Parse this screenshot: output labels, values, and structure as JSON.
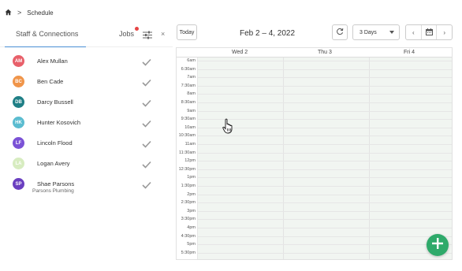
{
  "breadcrumb": {
    "home_icon": "home-icon",
    "separator": ">",
    "current": "Schedule"
  },
  "left_panel": {
    "tabs": {
      "staff": "Staff & Connections",
      "jobs": "Jobs"
    },
    "close": "×",
    "staff": [
      {
        "initials": "AM",
        "name": "Alex Mullan",
        "color": "#e8606a",
        "sub": ""
      },
      {
        "initials": "BC",
        "name": "Ben Cade",
        "color": "#f0954a",
        "sub": ""
      },
      {
        "initials": "DB",
        "name": "Darcy Bussell",
        "color": "#1f7f86",
        "sub": ""
      },
      {
        "initials": "HK",
        "name": "Hunter Kosovich",
        "color": "#5bbcd0",
        "sub": ""
      },
      {
        "initials": "LF",
        "name": "Lincoln Flood",
        "color": "#7b52d6",
        "sub": ""
      },
      {
        "initials": "LA",
        "name": "Logan Avery",
        "color": "#d7ecc0",
        "sub": ""
      },
      {
        "initials": "SP",
        "name": "Shae Parsons",
        "color": "#6a3fc0",
        "sub": "Parsons Plumbing"
      }
    ]
  },
  "toolbar": {
    "today": "Today",
    "date_range": "Feb 2 – 4, 2022",
    "view": "3 Days",
    "prev": "‹",
    "next": "›"
  },
  "calendar": {
    "days": [
      "Wed 2",
      "Thu 3",
      "Fri 4"
    ],
    "times": [
      "6am",
      "6:30am",
      "7am",
      "7:30am",
      "8am",
      "8:30am",
      "9am",
      "9:30am",
      "10am",
      "10:30am",
      "11am",
      "11:30am",
      "12pm",
      "12:30pm",
      "1pm",
      "1:30pm",
      "2pm",
      "2:30pm",
      "3pm",
      "3:30pm",
      "4pm",
      "4:30pm",
      "5pm",
      "5:30pm"
    ]
  },
  "colors": {
    "accent": "#4a8fd4",
    "fab": "#2eaa6a",
    "jobs_dot": "#e64545"
  }
}
